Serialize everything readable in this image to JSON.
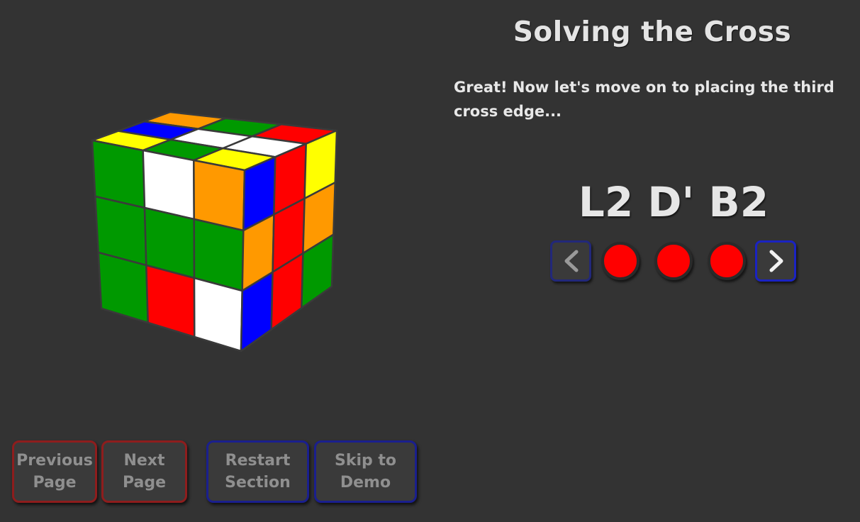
{
  "header": {
    "title": "Solving the Cross"
  },
  "instructions": {
    "text": "Great! Now let's move on to placing the third cross edge..."
  },
  "algorithm": {
    "moves": "L2 D' B2",
    "step_count": 3
  },
  "step_nav": {
    "prev_icon": "chevron-left-icon",
    "next_icon": "chevron-right-icon",
    "dot_color": "#ff0000"
  },
  "footer": {
    "previous_page": "Previous Page",
    "next_page": "Next Page",
    "restart_section": "Restart Section",
    "skip_to_demo": "Skip to Demo"
  },
  "colors": {
    "background": "#333333",
    "green": "#009900",
    "white": "#ffffff",
    "orange": "#ff9900",
    "blue": "#0000ff",
    "red": "#ff0000",
    "yellow": "#ffff00",
    "prev_border": "#8e1d1d",
    "section_border": "#1a1f8e"
  },
  "cube": {
    "top_face": [
      [
        "orange",
        "green",
        "red"
      ],
      [
        "blue",
        "white",
        "white"
      ],
      [
        "yellow",
        "green",
        "yellow"
      ]
    ],
    "front_face": [
      [
        "green",
        "white",
        "orange"
      ],
      [
        "green",
        "green",
        "green"
      ],
      [
        "green",
        "red",
        "white"
      ]
    ],
    "right_face": [
      [
        "blue",
        "red",
        "yellow"
      ],
      [
        "orange",
        "red",
        "orange"
      ],
      [
        "blue",
        "red",
        "green"
      ]
    ]
  }
}
